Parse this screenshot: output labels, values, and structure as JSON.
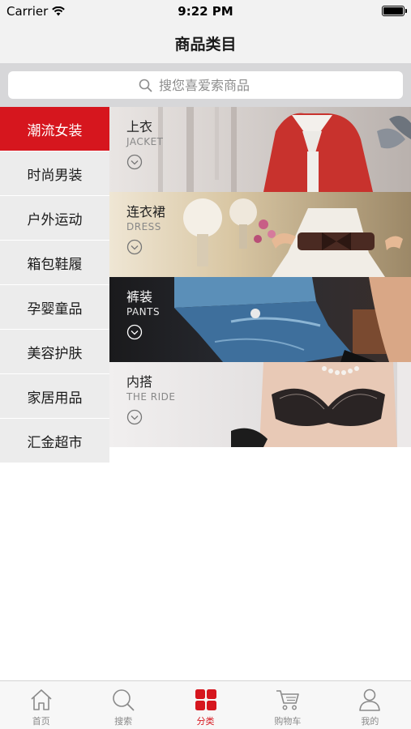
{
  "status": {
    "carrier": "Carrier",
    "time": "9:22 PM"
  },
  "nav": {
    "title": "商品类目"
  },
  "search": {
    "placeholder": "搜您喜爱索商品"
  },
  "sidebar": {
    "active_index": 0,
    "items": [
      {
        "label": "潮流女装"
      },
      {
        "label": "时尚男装"
      },
      {
        "label": "户外运动"
      },
      {
        "label": "箱包鞋履"
      },
      {
        "label": "孕婴童品"
      },
      {
        "label": "美容护肤"
      },
      {
        "label": "家居用品"
      },
      {
        "label": "汇金超市"
      }
    ]
  },
  "subcategories": [
    {
      "cn": "上衣",
      "en": "JACKET"
    },
    {
      "cn": "连衣裙",
      "en": "DRESS"
    },
    {
      "cn": "裤装",
      "en": "PANTS"
    },
    {
      "cn": "内搭",
      "en": "THE RIDE"
    }
  ],
  "tabbar": {
    "active_index": 2,
    "items": [
      {
        "label": "首页",
        "icon": "home-icon"
      },
      {
        "label": "搜索",
        "icon": "search-icon"
      },
      {
        "label": "分类",
        "icon": "category-grid-icon"
      },
      {
        "label": "购物车",
        "icon": "cart-icon"
      },
      {
        "label": "我的",
        "icon": "user-icon"
      }
    ]
  },
  "colors": {
    "accent": "#d6161e",
    "sidebar_bg": "#ececec",
    "search_bg": "#d7d7d9"
  }
}
